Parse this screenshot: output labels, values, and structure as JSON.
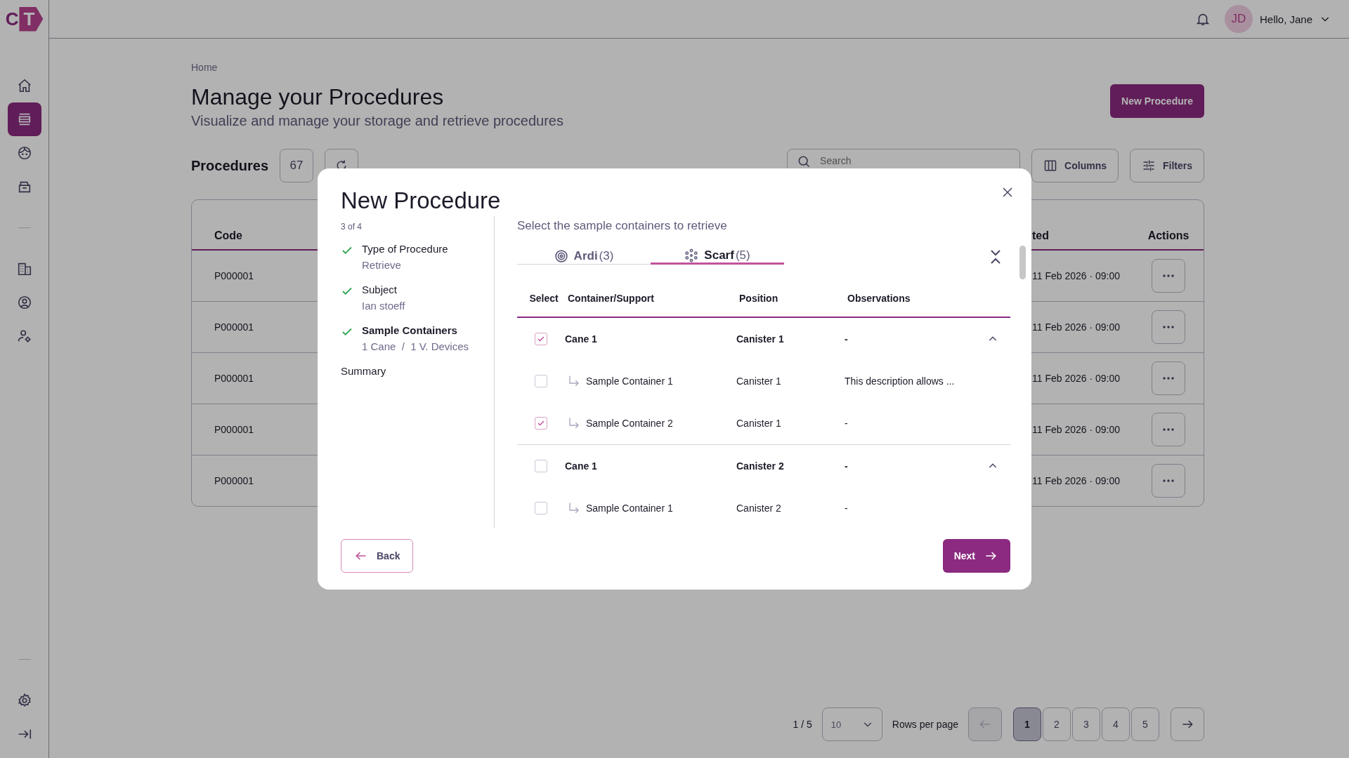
{
  "app": {
    "logo": [
      "C",
      "T"
    ]
  },
  "sidebar": {
    "sections": [
      {
        "items": [
          {
            "kind": "home",
            "selected": false
          },
          {
            "kind": "procedures",
            "selected": true
          },
          {
            "kind": "face",
            "selected": false
          },
          {
            "kind": "box",
            "selected": false
          }
        ]
      },
      {
        "items": [
          {
            "kind": "building",
            "selected": false
          },
          {
            "kind": "user",
            "selected": false
          },
          {
            "kind": "user-settings",
            "selected": false
          }
        ]
      },
      {
        "items": [
          {
            "kind": "settings",
            "selected": false
          },
          {
            "kind": "collapse",
            "selected": false
          }
        ]
      }
    ]
  },
  "header": {
    "avatar_initials": "JD",
    "greeting": "Hello, Jane"
  },
  "page": {
    "breadcrumb": "Home",
    "title": "Manage your Procedures",
    "subtitle": "Visualize and manage your storage and retrieve procedures",
    "primary_button": "New Procedure",
    "list_title": "Procedures",
    "count": "67",
    "search": {
      "placeholder": "Search"
    },
    "columns_button": "Columns",
    "filters_button": "Filters"
  },
  "table": {
    "columns": [
      "Code",
      "ted",
      "Actions"
    ],
    "rows": [
      {
        "code": "P000001",
        "date": "11 Feb 2026 · 09:00"
      },
      {
        "code": "P000001",
        "date": "11 Feb 2026 · 09:00"
      },
      {
        "code": "P000001",
        "date": "11 Feb 2026 · 09:00"
      },
      {
        "code": "P000001",
        "date": "11 Feb 2026 · 09:00"
      },
      {
        "code": "P000001",
        "date": "11 Feb 2026 · 09:00"
      }
    ]
  },
  "pagination": {
    "page_info": "1 / 5",
    "rows_per_page_value": "10",
    "rows_per_page_label": "Rows per page",
    "prev_disabled": true,
    "pages": [
      {
        "label": "1",
        "selected": true
      },
      {
        "label": "2",
        "selected": false
      },
      {
        "label": "3",
        "selected": false
      },
      {
        "label": "4",
        "selected": false
      },
      {
        "label": "5",
        "selected": false
      }
    ]
  },
  "modal": {
    "title": "New Procedure",
    "step_counter": "3 of 4",
    "steps": [
      {
        "title": "Type of Procedure",
        "value": "Retrieve",
        "done": true,
        "selected": false
      },
      {
        "title": "Subject",
        "value": "Ian stoeff",
        "done": true,
        "selected": false
      },
      {
        "title": "Sample Containers",
        "value": "1 Cane  /  1 V. Devices",
        "done": true,
        "selected": true
      },
      {
        "title": "Summary",
        "done": false,
        "selected": false
      }
    ],
    "instruction": "Select the sample containers to retrieve",
    "tabs": [
      {
        "kind": "target",
        "label": "Ardi",
        "count": "(3)",
        "selected": false
      },
      {
        "kind": "dots",
        "label": "Scarf",
        "count": "(5)",
        "selected": true
      }
    ],
    "table": {
      "columns": [
        "Select",
        "Container/Support",
        "Position",
        "Observations"
      ],
      "rows": [
        {
          "kind": "group",
          "checked": true,
          "expanded": true,
          "name": "Cane 1",
          "position": "Canister 1",
          "observations": "-"
        },
        {
          "kind": "child",
          "checked": false,
          "name": "Sample Container 1",
          "position": "Canister 1",
          "observations": "This description allows ..."
        },
        {
          "kind": "child",
          "checked": true,
          "name": "Sample Container 2",
          "position": "Canister 1",
          "observations": "-"
        },
        {
          "kind": "group",
          "checked": false,
          "expanded": true,
          "name": "Cane 1",
          "position": "Canister 2",
          "observations": "-"
        },
        {
          "kind": "child",
          "checked": false,
          "name": "Sample Container 1",
          "position": "Canister 2",
          "observations": "-"
        }
      ]
    },
    "back_button": "Back",
    "next_button": "Next"
  }
}
